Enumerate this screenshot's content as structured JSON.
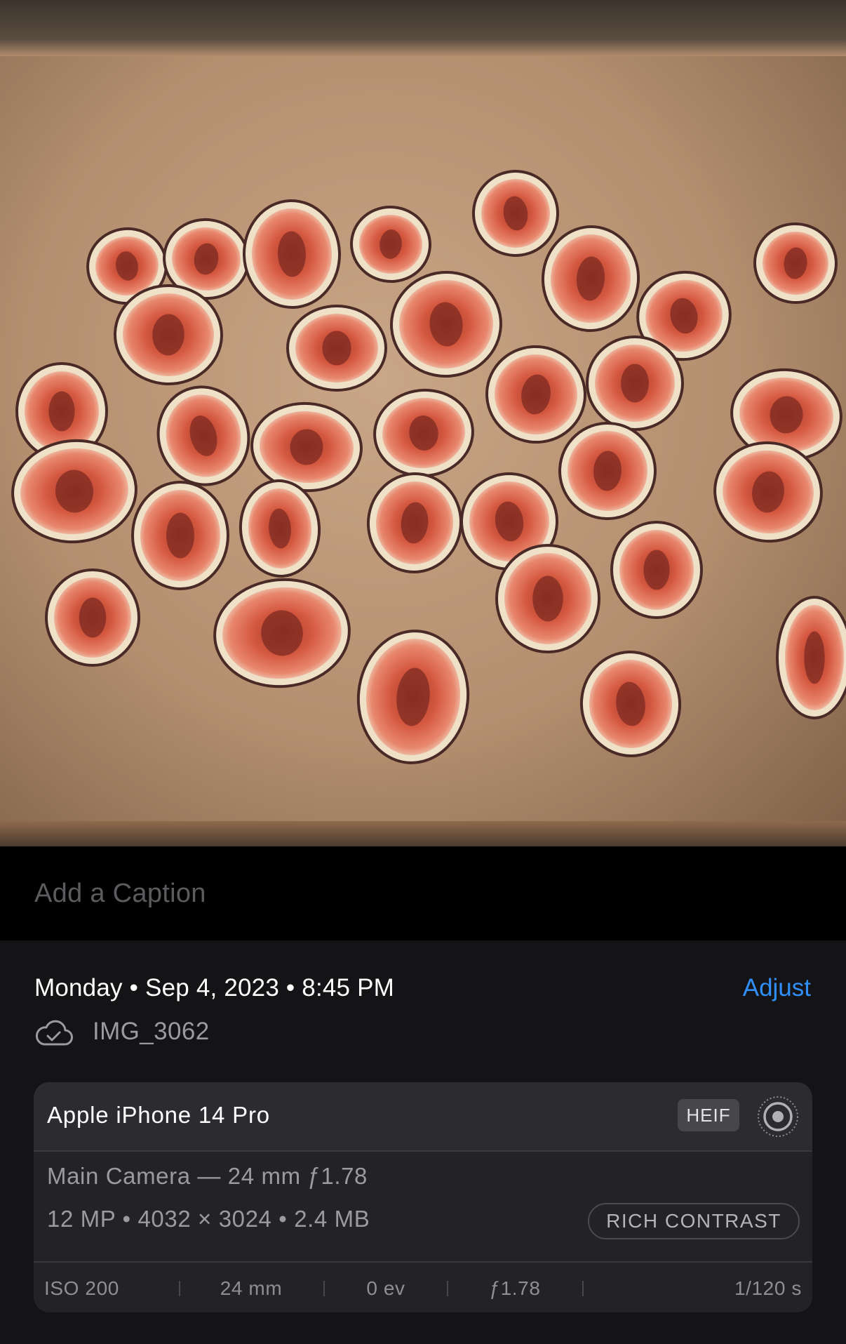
{
  "photo": {
    "subject": "halved figs on parchment-lined baking tray",
    "figs": [
      [
        181,
        379,
        58,
        55,
        -10
      ],
      [
        294,
        369,
        62,
        58,
        8
      ],
      [
        416,
        362,
        70,
        78,
        -2
      ],
      [
        557,
        348,
        58,
        55,
        5
      ],
      [
        735,
        304,
        62,
        62,
        -8
      ],
      [
        1134,
        375,
        60,
        58,
        6
      ],
      [
        240,
        477,
        78,
        72,
        2
      ],
      [
        480,
        496,
        72,
        62,
        0
      ],
      [
        636,
        462,
        80,
        76,
        -5
      ],
      [
        842,
        397,
        70,
        76,
        4
      ],
      [
        975,
        450,
        68,
        64,
        -12
      ],
      [
        88,
        586,
        66,
        70,
        0
      ],
      [
        290,
        621,
        66,
        72,
        -15
      ],
      [
        437,
        637,
        80,
        64,
        4
      ],
      [
        604,
        617,
        72,
        63,
        -6
      ],
      [
        764,
        562,
        72,
        70,
        8
      ],
      [
        905,
        546,
        70,
        68,
        0
      ],
      [
        1121,
        591,
        80,
        66,
        6
      ],
      [
        106,
        700,
        90,
        74,
        -5
      ],
      [
        257,
        763,
        70,
        78,
        0
      ],
      [
        399,
        753,
        58,
        70,
        -4
      ],
      [
        591,
        745,
        68,
        72,
        5
      ],
      [
        726,
        743,
        70,
        70,
        -8
      ],
      [
        866,
        671,
        70,
        70,
        3
      ],
      [
        936,
        812,
        66,
        70,
        0
      ],
      [
        1095,
        701,
        78,
        72,
        8
      ],
      [
        132,
        880,
        68,
        70,
        0
      ],
      [
        402,
        902,
        98,
        78,
        -5
      ],
      [
        589,
        993,
        80,
        96,
        5
      ],
      [
        781,
        853,
        75,
        78,
        0
      ],
      [
        899,
        1003,
        72,
        76,
        -6
      ],
      [
        1161,
        937,
        55,
        88,
        0
      ]
    ]
  },
  "caption": {
    "placeholder": "Add a Caption"
  },
  "info": {
    "date_line": "Monday • Sep 4, 2023 • 8:45 PM",
    "adjust_label": "Adjust",
    "cloud_icon": "cloud-check-icon",
    "filename": "IMG_3062",
    "accent_color": "#2f8ff6"
  },
  "camera_card": {
    "device": "Apple iPhone 14 Pro",
    "format_badge": "HEIF",
    "live_icon": "live-photo-icon",
    "camera": "Main Camera — 24 mm ƒ1.78",
    "specs": "12 MP  •  4032 × 3024  •  2.4 MB",
    "style_badge": "RICH CONTRAST",
    "exif": [
      "ISO 200",
      "24 mm",
      "0 ev",
      "ƒ1.78",
      "1/120 s"
    ]
  }
}
